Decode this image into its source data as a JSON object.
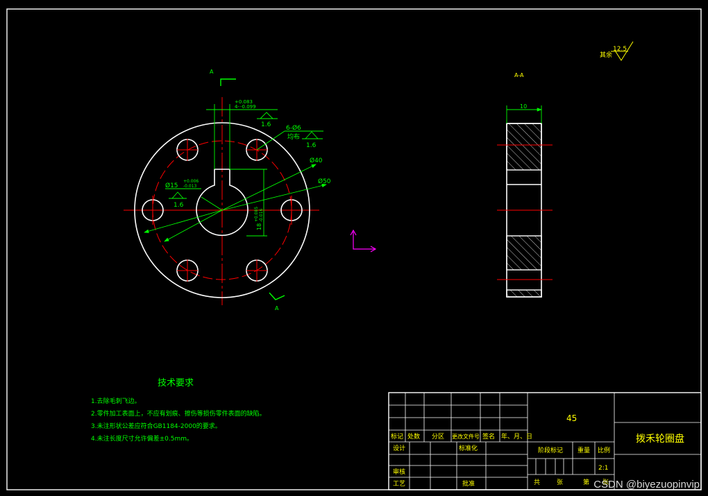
{
  "colors": {
    "background": "#000000",
    "outline": "#ffffff",
    "dimension": "#00ff00",
    "centerline": "#ff0000",
    "text_green": "#00ff00",
    "text_yellow": "#ffff00",
    "ucs": "#ff00ff"
  },
  "roughness_default": {
    "label": "其余",
    "value": "12.5"
  },
  "section_label": "A-A",
  "cut_marker": "A",
  "front_view": {
    "tol_upper": "+0.083",
    "tol_prefix": "4-",
    "tol_lower": "-0.099",
    "hole_note": "6-Ø6",
    "hole_note_sub": "均布",
    "dia_pitch": "Ø40",
    "dia_outer": "Ø50",
    "bore_dim": "Ø15",
    "bore_tol_upper": "+0.006",
    "bore_tol_lower": "-0.013",
    "keyway_dim": "18",
    "keyway_tol_upper": "+0.085",
    "keyway_tol_lower": "-0.016",
    "roughness": [
      "1.6",
      "1.6",
      "1.6"
    ]
  },
  "side_view": {
    "width_dim": "10"
  },
  "tech": {
    "title": "技术要求",
    "items": [
      "1.去除毛刺飞边。",
      "2.零件加工表面上，不应有划痕、擦伤等损伤零件表面的缺陷。",
      "3.未注形状公差应符合GB1184-2000的要求。",
      "4.未注长度尺寸允许偏差±0.5mm。"
    ]
  },
  "title_block": {
    "material": "45",
    "part_name": "拨禾轮圈盘",
    "header_cells": [
      "标记",
      "处数",
      "分区",
      "更改文件号",
      "签名",
      "年、月、日"
    ],
    "design": "设计",
    "standardize": "标准化",
    "review": "审核",
    "process": "工艺",
    "approve": "批准",
    "stage_mark": "阶段标记",
    "weight": "重量",
    "scale": "比例",
    "scale_value": "2:1",
    "total": "共",
    "sheets": "张",
    "sheet_no": "第",
    "sheet_unit": "张"
  },
  "watermark": "CSDN @biyezuopinvip"
}
